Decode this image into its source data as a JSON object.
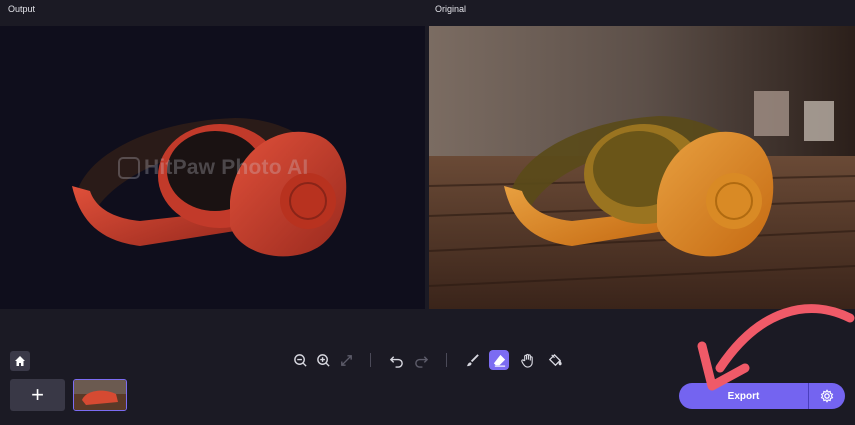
{
  "labels": {
    "output": "Output",
    "original": "Original"
  },
  "watermark": "HitPaw Photo AI",
  "toolbar": {
    "icons": [
      "home-icon",
      "zoom-out-icon",
      "zoom-in-icon",
      "fit-icon",
      "undo-icon",
      "redo-icon",
      "brush-icon",
      "eraser-icon",
      "hand-icon",
      "fill-icon"
    ],
    "add_label": "+"
  },
  "export": {
    "label": "Export"
  },
  "colors": {
    "accent": "#7464f0",
    "arrow": "#f05a68"
  }
}
